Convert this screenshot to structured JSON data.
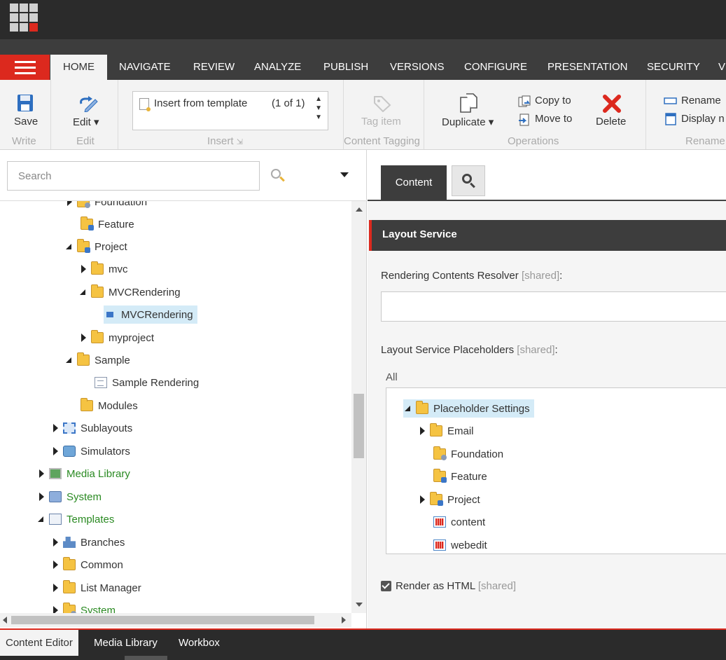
{
  "ribbon_tabs": [
    "HOME",
    "NAVIGATE",
    "REVIEW",
    "ANALYZE",
    "PUBLISH",
    "VERSIONS",
    "CONFIGURE",
    "PRESENTATION",
    "SECURITY",
    "VI"
  ],
  "ribbon": {
    "save": "Save",
    "edit": "Edit",
    "insert_item": "Insert from template",
    "insert_count": "(1 of 1)",
    "tag_item": "Tag item",
    "duplicate": "Duplicate",
    "copy_to": "Copy to",
    "move_to": "Move to",
    "delete": "Delete",
    "rename": "Rename",
    "display_name": "Display n",
    "groups": {
      "write": "Write",
      "edit": "Edit",
      "insert": "Insert",
      "content_tagging": "Content Tagging",
      "operations": "Operations",
      "rename": "Rename"
    }
  },
  "search": {
    "placeholder": "Search"
  },
  "tree": [
    {
      "label": "Foundation"
    },
    {
      "label": "Feature"
    },
    {
      "label": "Project"
    },
    {
      "label": "mvc"
    },
    {
      "label": "MVCRendering"
    },
    {
      "label": "MVCRendering"
    },
    {
      "label": "myproject"
    },
    {
      "label": "Sample"
    },
    {
      "label": "Sample Rendering"
    },
    {
      "label": "Modules"
    },
    {
      "label": "Sublayouts"
    },
    {
      "label": "Simulators"
    },
    {
      "label": "Media Library"
    },
    {
      "label": "System"
    },
    {
      "label": "Templates"
    },
    {
      "label": "Branches"
    },
    {
      "label": "Common"
    },
    {
      "label": "List Manager"
    },
    {
      "label": "System"
    }
  ],
  "editor": {
    "tab_content": "Content",
    "section_title": "Layout Service",
    "field_resolver": "Rendering Contents Resolver",
    "field_placeholders": "Layout Service Placeholders",
    "shared_tag": "[shared]",
    "colon": ":",
    "all_label": "All",
    "placeholder_tree": [
      {
        "label": "Placeholder Settings"
      },
      {
        "label": "Email"
      },
      {
        "label": "Foundation"
      },
      {
        "label": "Feature"
      },
      {
        "label": "Project"
      },
      {
        "label": "content"
      },
      {
        "label": "webedit"
      }
    ],
    "render_html": "Render as HTML"
  },
  "bottom_tabs": [
    "Content Editor",
    "Media Library",
    "Workbox"
  ]
}
